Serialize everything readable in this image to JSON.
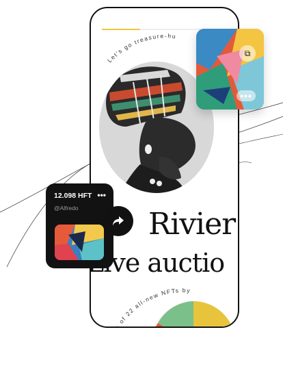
{
  "screen": {
    "arc_heading": "Let's go treasure-hu",
    "headline_line1": "Rivier",
    "headline_line2": "Live auctio",
    "bottom_arc_text": "n of 22 all-new NFTs by",
    "progress_fraction": 0.33
  },
  "wallet_card": {
    "amount": "12.098 HFT",
    "more_icon": "•••",
    "username": "@Alfredo"
  },
  "nft_card": {
    "copy_icon": "copy-icon",
    "more_label": "•••"
  },
  "share_button": {
    "icon": "share-arrow-icon"
  },
  "colors": {
    "accent_yellow": "#f0c73a",
    "dark_card": "#121212",
    "ink": "#111111"
  }
}
